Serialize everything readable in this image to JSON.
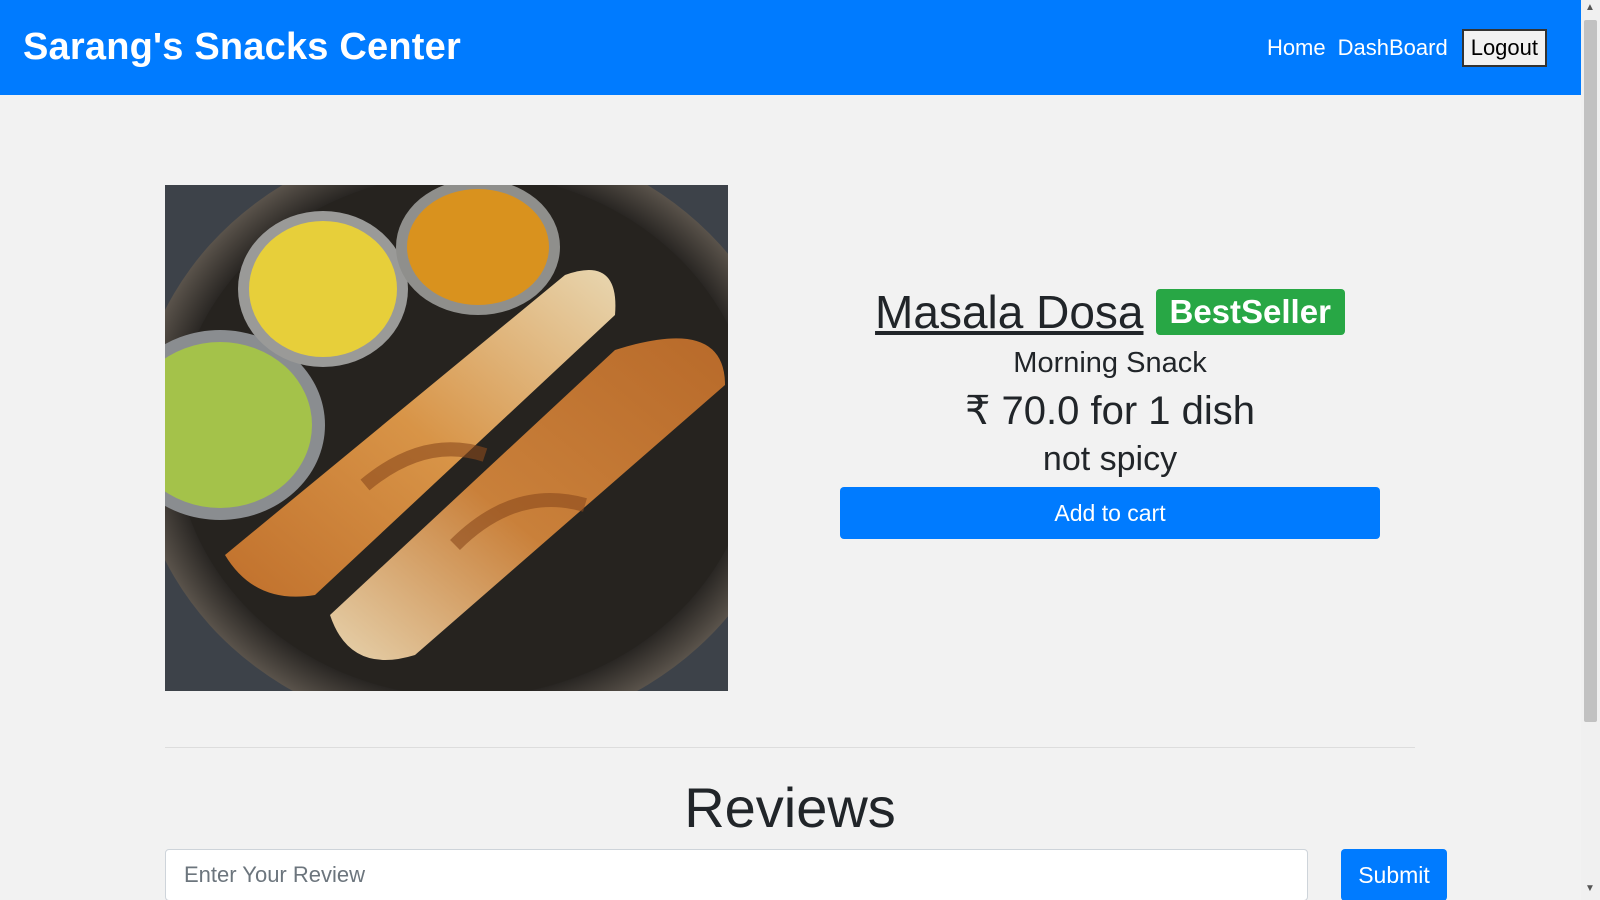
{
  "navbar": {
    "brand": "Sarang's Snacks Center",
    "links": [
      "Home",
      "DashBoard"
    ],
    "logout_label": "Logout"
  },
  "product": {
    "name": "Masala Dosa",
    "badge": "BestSeller",
    "category": "Morning Snack",
    "price_text": "₹ 70.0 for 1 dish",
    "spice_level": "not spicy",
    "add_to_cart_label": "Add to cart",
    "image_icon": "masala-dosa-photo"
  },
  "reviews": {
    "title": "Reviews",
    "input_placeholder": "Enter Your Review",
    "input_value": "",
    "submit_label": "Submit"
  },
  "colors": {
    "primary": "#007bff",
    "badge_green": "#28a745",
    "background": "#f2f2f2"
  }
}
